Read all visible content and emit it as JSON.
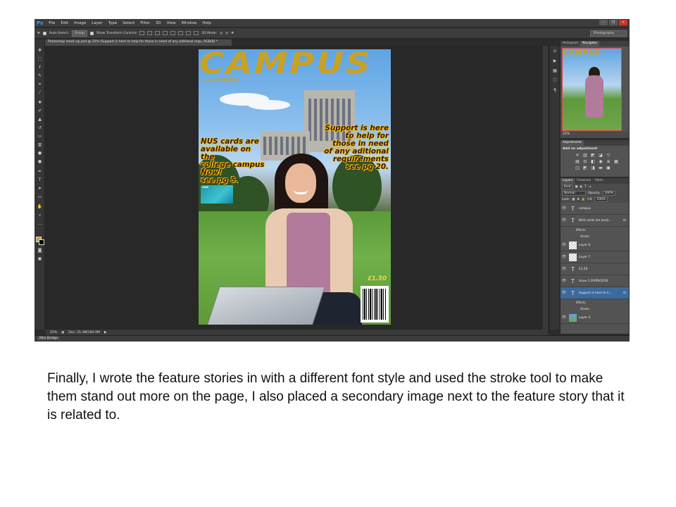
{
  "app": {
    "logo": "Ps",
    "menu": [
      "File",
      "Edit",
      "Image",
      "Layer",
      "Type",
      "Select",
      "Filter",
      "3D",
      "View",
      "Window",
      "Help"
    ],
    "window_controls": [
      "–",
      "❐",
      "✕"
    ]
  },
  "options_bar": {
    "auto_select_label": "Auto-Select:",
    "auto_select_value": "Group",
    "transform_label": "Show Transform Controls",
    "mode_label": "3D Mode:",
    "workspace": "Photography"
  },
  "document": {
    "tab_title": "Photoshop mock up.psd @ 25% (Support is here to help for those in need of any aditional requ, RGB/8) *",
    "zoom": "25%",
    "doc_size": "Doc: 25.3M/180.0M",
    "mini_bridge": "Mini Bridge"
  },
  "cover": {
    "masthead": "CAMPUS",
    "issue": "Issue 3 2009/2010",
    "story_left": [
      "NUS cards are",
      "available on the",
      "college campus",
      "Now!",
      "see pg 5."
    ],
    "card_label": "nus",
    "story_right": [
      "Support is here",
      "to help for",
      "those in need",
      "of any aditional",
      "requirements",
      "see pg 20."
    ],
    "price": "£1.50"
  },
  "panels": {
    "top_tabs": [
      "Histogram",
      "Navigator"
    ],
    "navigator_zoom": "25%",
    "navigator_thumb_title": "CAMPUS",
    "adjustments_tab": "Adjustments",
    "adjustments_title": "Add an adjustment",
    "layers_tabs": [
      "Layers",
      "Channels",
      "Paths"
    ],
    "kind_label": "Kind",
    "blend_mode": "Normal",
    "opacity_label": "Opacity:",
    "opacity_value": "100%",
    "lock_label": "Lock:",
    "fill_label": "Fill:",
    "fill_value": "100%",
    "layers": [
      {
        "name": "campus",
        "type": "text"
      },
      {
        "name": "NUS cards are avail...",
        "type": "text",
        "fx": "fx"
      },
      {
        "name": "Layer 6",
        "type": "pixel"
      },
      {
        "name": "Layer 7",
        "type": "pixel"
      },
      {
        "name": "£1.50",
        "type": "text"
      },
      {
        "name": "Issue 3 20/09/2016",
        "type": "text"
      },
      {
        "name": "Support is here to h...",
        "type": "text",
        "fx": "fx",
        "selected": true
      },
      {
        "name": "Layer 4",
        "type": "image"
      }
    ],
    "effects_label": "Effects",
    "stroke_label": "Stroke"
  },
  "caption": "Finally, I wrote the feature stories in with a different font style and used the stroke tool to make them stand out more on the page, I also placed a secondary image next to the feature story that it is related to.",
  "colors": {
    "ui_dark": "#2b2b2b",
    "panel": "#535353",
    "masthead": "#c8a125",
    "selection": "#3d6a9e"
  }
}
